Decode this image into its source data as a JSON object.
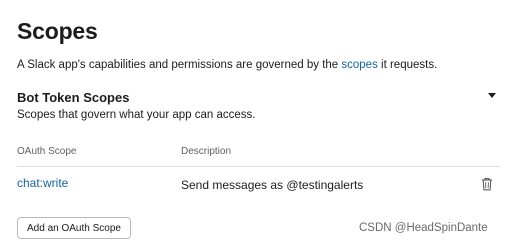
{
  "header": {
    "title": "Scopes",
    "intro_before": "A Slack app's capabilities and permissions are governed by the ",
    "intro_link": "scopes",
    "intro_after": " it requests."
  },
  "section": {
    "title": "Bot Token Scopes",
    "subtitle": "Scopes that govern what your app can access.",
    "toggle_icon": "caret-down-icon"
  },
  "table": {
    "columns": [
      "OAuth Scope",
      "Description"
    ],
    "rows": [
      {
        "scope": "chat:write",
        "description": "Send messages as @testingalerts",
        "action_icon": "trash-icon"
      }
    ]
  },
  "actions": {
    "add_label": "Add an OAuth Scope"
  },
  "watermark": "CSDN @HeadSpinDante",
  "colors": {
    "text": "#1d1c1d",
    "link": "#1264a3",
    "muted": "#616061",
    "border": "#dddddd"
  }
}
